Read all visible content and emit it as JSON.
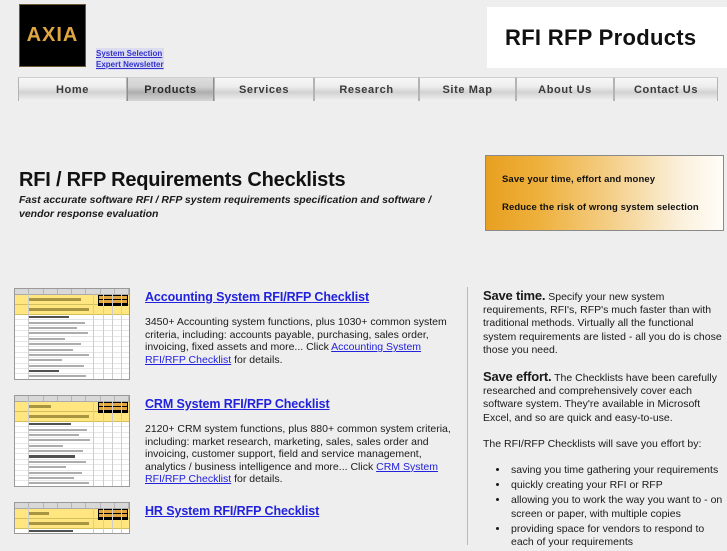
{
  "header": {
    "logo_text": "AXIA",
    "links": [
      {
        "label": "System Selection"
      },
      {
        "label": "Expert Newsletter"
      }
    ],
    "title": "RFI RFP Products"
  },
  "nav": {
    "tabs": [
      {
        "label": "Home",
        "active": false
      },
      {
        "label": "Products",
        "active": true
      },
      {
        "label": "Services",
        "active": false
      },
      {
        "label": "Research",
        "active": false
      },
      {
        "label": "Site Map",
        "active": false
      },
      {
        "label": "About Us",
        "active": false
      },
      {
        "label": "Contact Us",
        "active": false
      }
    ]
  },
  "page": {
    "heading": "RFI / RFP Requirements Checklists",
    "subheading": "Fast accurate software RFI / RFP system requirements specification and software / vendor response evaluation"
  },
  "promo": {
    "line1": "Save your time, effort and money",
    "line2": "Reduce the risk of wrong system selection",
    "gradient_from": "#e8a020",
    "gradient_to": "#fffdf8"
  },
  "products": [
    {
      "title": "Accounting System RFI/RFP Checklist",
      "desc_before": "3450+ Accounting system functions, plus 1030+ common system criteria, including: accounts payable, purchasing, sales order, invoicing, fixed assets and more... Click ",
      "desc_link": "Accounting System RFI/RFP Checklist",
      "desc_after": " for details.",
      "thumb_name": "accounting-checklist-thumbnail"
    },
    {
      "title": "CRM System RFI/RFP Checklist",
      "desc_before": "2120+ CRM system functions, plus 880+ common system criteria, including: market research, marketing, sales, sales order and invoicing, customer support, field and service management, analytics / business intelligence and more... Click ",
      "desc_link": "CRM System RFI/RFP Checklist",
      "desc_after": " for details.",
      "thumb_name": "crm-checklist-thumbnail"
    },
    {
      "title": "HR System RFI/RFP Checklist",
      "desc_before": "",
      "desc_link": "",
      "desc_after": "",
      "thumb_name": "hr-checklist-thumbnail"
    }
  ],
  "sidebar": {
    "save_time_lead": "Save time.",
    "save_time_text": " Specify your new system requirements, RFI's, RFP's much faster than with traditional methods. Virtually all the functional system requirements are listed - all you do is chose those you need.",
    "save_effort_lead": "Save effort.",
    "save_effort_text": " The Checklists have been carefully researched and comprehensively cover each software system. They're available in Microsoft Excel, and so are quick and easy-to-use.",
    "effort_intro": "The RFI/RFP Checklists will save you effort by:",
    "bullets": [
      "saving you time gathering your requirements",
      "quickly creating your RFI or RFP",
      "allowing you to work the way you want to - on screen or paper, with multiple copies",
      "providing space for vendors to respond to each of your requirements"
    ]
  },
  "colors": {
    "page_bg": "#eeeeee",
    "link": "#2222dd",
    "logo_gold": "#e0a642",
    "accent_orange": "#e8a020"
  }
}
